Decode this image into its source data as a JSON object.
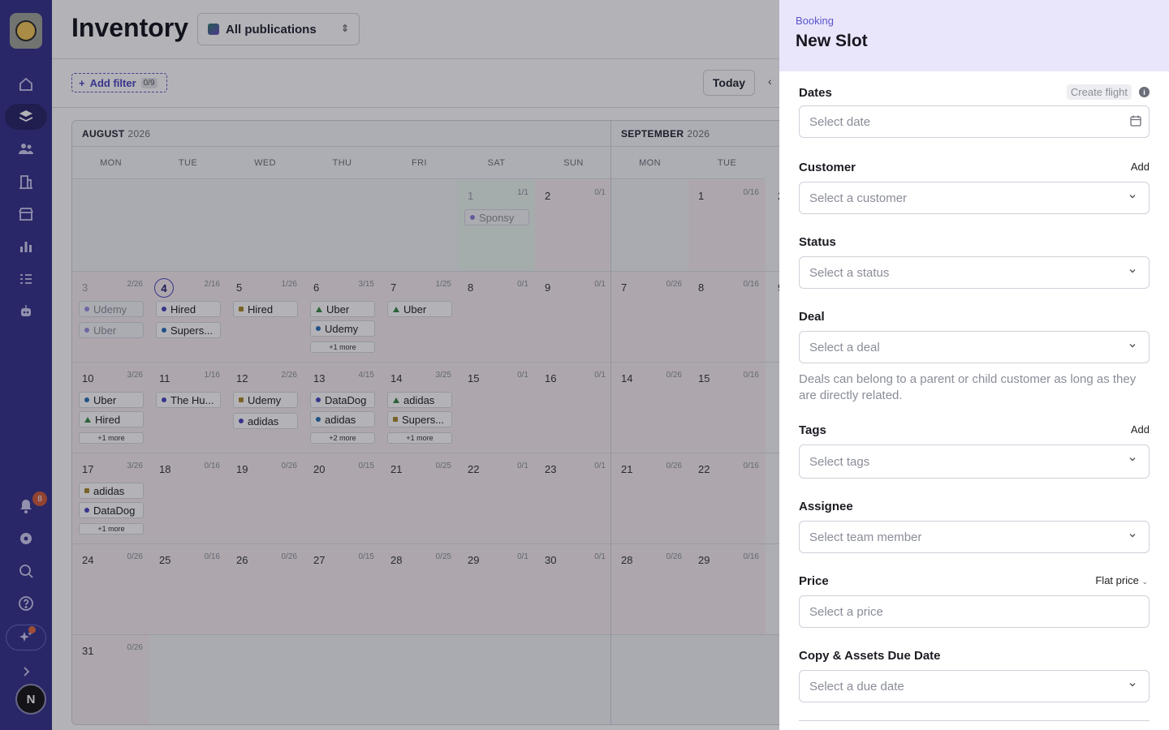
{
  "sidebar": {
    "notifications_badge": "8",
    "avatar_initial": "N"
  },
  "header": {
    "title": "Inventory",
    "publication_select": "All publications"
  },
  "toolbar": {
    "add_filter_label": "Add filter",
    "filter_count": "0/9",
    "today_label": "Today"
  },
  "calendar": {
    "months": [
      {
        "name": "AUGUST",
        "year": "2026"
      },
      {
        "name": "SEPTEMBER",
        "year": "2026"
      }
    ],
    "weekdays_aug": [
      "MON",
      "TUE",
      "WED",
      "THU",
      "FRI",
      "SAT",
      "SUN"
    ],
    "weekdays_sep": [
      "MON",
      "TUE"
    ],
    "cells": {
      "aug1": {
        "day": "1",
        "cap": "1/1"
      },
      "aug2": {
        "day": "2",
        "cap": "0/1"
      },
      "sep1": {
        "day": "1",
        "cap": "0/16"
      },
      "aug3": {
        "day": "3",
        "cap": "2/26"
      },
      "aug4": {
        "day": "4",
        "cap": "2/16"
      },
      "aug5": {
        "day": "5",
        "cap": "1/26"
      },
      "aug6": {
        "day": "6",
        "cap": "3/15"
      },
      "aug7": {
        "day": "7",
        "cap": "1/25"
      },
      "aug8": {
        "day": "8",
        "cap": "0/1"
      },
      "aug9": {
        "day": "9",
        "cap": "0/1"
      },
      "sep7": {
        "day": "7",
        "cap": "0/26"
      },
      "sep8": {
        "day": "8",
        "cap": "0/16"
      },
      "aug10": {
        "day": "10",
        "cap": "3/26"
      },
      "aug11": {
        "day": "11",
        "cap": "1/16"
      },
      "aug12": {
        "day": "12",
        "cap": "2/26"
      },
      "aug13": {
        "day": "13",
        "cap": "4/15"
      },
      "aug14": {
        "day": "14",
        "cap": "3/25"
      },
      "aug15": {
        "day": "15",
        "cap": "0/1"
      },
      "aug16": {
        "day": "16",
        "cap": "0/1"
      },
      "sep14": {
        "day": "14",
        "cap": "0/26"
      },
      "sep15": {
        "day": "15",
        "cap": "0/16"
      },
      "aug17": {
        "day": "17",
        "cap": "3/26"
      },
      "aug18": {
        "day": "18",
        "cap": "0/16"
      },
      "aug19": {
        "day": "19",
        "cap": "0/26"
      },
      "aug20": {
        "day": "20",
        "cap": "0/15"
      },
      "aug21": {
        "day": "21",
        "cap": "0/25"
      },
      "aug22": {
        "day": "22",
        "cap": "0/1"
      },
      "aug23": {
        "day": "23",
        "cap": "0/1"
      },
      "sep21": {
        "day": "21",
        "cap": "0/26"
      },
      "sep22": {
        "day": "22",
        "cap": "0/16"
      },
      "aug24": {
        "day": "24",
        "cap": "0/26"
      },
      "aug25": {
        "day": "25",
        "cap": "0/16"
      },
      "aug26": {
        "day": "26",
        "cap": "0/26"
      },
      "aug27": {
        "day": "27",
        "cap": "0/15"
      },
      "aug28": {
        "day": "28",
        "cap": "0/25"
      },
      "aug29": {
        "day": "29",
        "cap": "0/1"
      },
      "aug30": {
        "day": "30",
        "cap": "0/1"
      },
      "sep28": {
        "day": "28",
        "cap": "0/26"
      },
      "sep29": {
        "day": "29",
        "cap": "0/16"
      },
      "aug31": {
        "day": "31",
        "cap": "0/26"
      }
    },
    "bookings": {
      "sponsy": "Sponsy",
      "udemy": "Udemy",
      "uber": "Uber",
      "hired": "Hired",
      "supers": "Supers...",
      "thehu": "The Hu...",
      "datadog": "DataDog",
      "adidas": "adidas",
      "more1": "+1 more",
      "more2": "+2 more"
    },
    "partial_numbers": [
      "2",
      "9"
    ]
  },
  "drawer": {
    "kicker": "Booking",
    "title": "New Slot",
    "dates": {
      "label": "Dates",
      "action": "Create flight",
      "placeholder": "Select date"
    },
    "customer": {
      "label": "Customer",
      "action": "Add",
      "placeholder": "Select a customer"
    },
    "status": {
      "label": "Status",
      "placeholder": "Select a status"
    },
    "deal": {
      "label": "Deal",
      "placeholder": "Select a deal",
      "help": "Deals can belong to a parent or child customer as long as they are directly related."
    },
    "tags": {
      "label": "Tags",
      "action": "Add",
      "placeholder": "Select tags"
    },
    "assignee": {
      "label": "Assignee",
      "placeholder": "Select team member"
    },
    "price": {
      "label": "Price",
      "mode": "Flat price",
      "placeholder": "Select a price"
    },
    "due": {
      "label": "Copy & Assets Due Date",
      "placeholder": "Select a due date"
    }
  },
  "colors": {
    "sidebar": "#34318a",
    "accent": "#5b54c9",
    "drawer_header": "#e9e6fb"
  }
}
